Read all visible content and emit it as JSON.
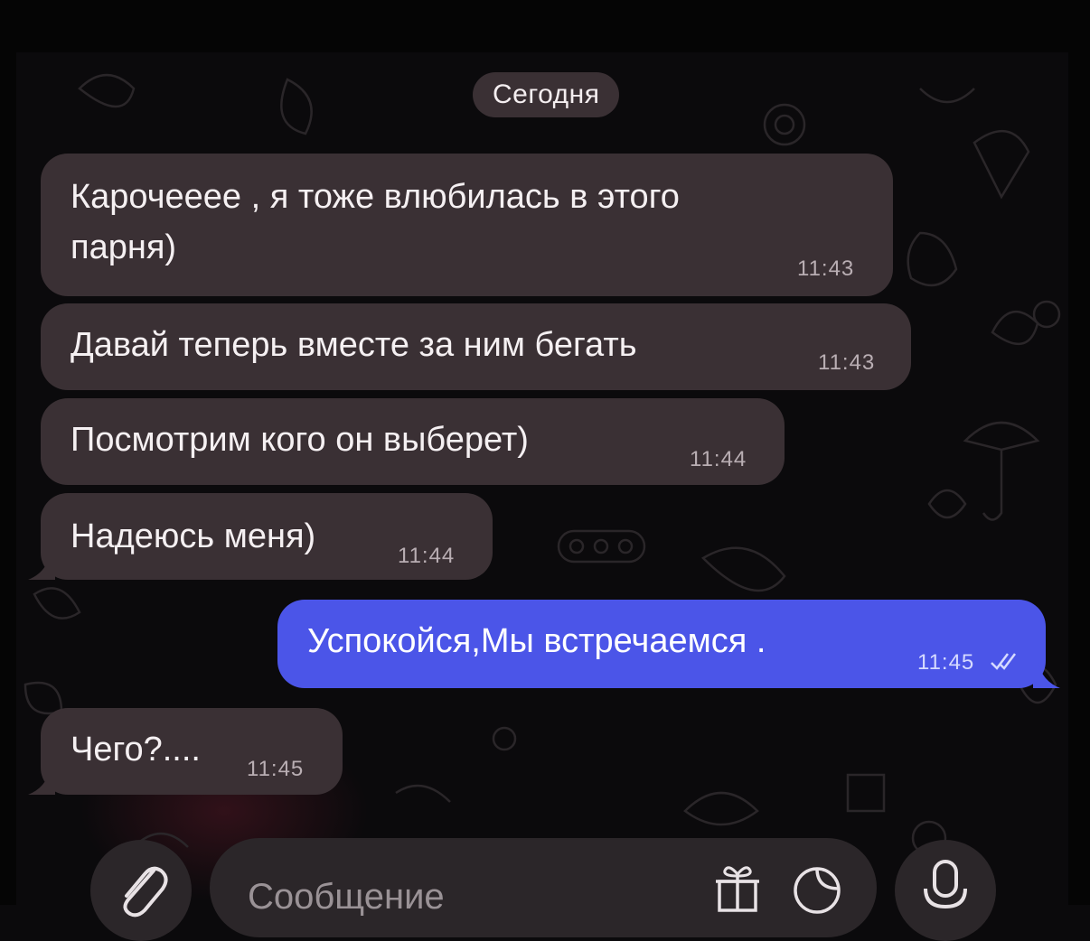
{
  "chat": {
    "date_separator": "Сегодня",
    "messages": [
      {
        "direction": "incoming",
        "lines": [
          "Карочееее , я тоже влюбилась в этого",
          "парня)"
        ],
        "time": "11:43"
      },
      {
        "direction": "incoming",
        "text": "Давай теперь вместе за ним бегать",
        "time": "11:43"
      },
      {
        "direction": "incoming",
        "text": "Посмотрим кого он выберет)",
        "time": "11:44"
      },
      {
        "direction": "incoming",
        "text": "Надеюсь меня)",
        "time": "11:44"
      },
      {
        "direction": "outgoing",
        "text": "Успокойся,Мы встречаемся .",
        "time": "11:45",
        "status": "read-double-check-icon"
      },
      {
        "direction": "incoming",
        "text": "Чего?....",
        "time": "11:45"
      }
    ]
  },
  "composer": {
    "placeholder": "Сообщение",
    "attach_icon": "paperclip-icon",
    "gift_icon": "gift-icon",
    "sticker_icon": "sticker-icon",
    "voice_icon": "microphone-icon"
  },
  "colors": {
    "incoming_bubble": "#3a3034",
    "outgoing_bubble": "#4b55e8",
    "background": "#0b0a0c"
  }
}
